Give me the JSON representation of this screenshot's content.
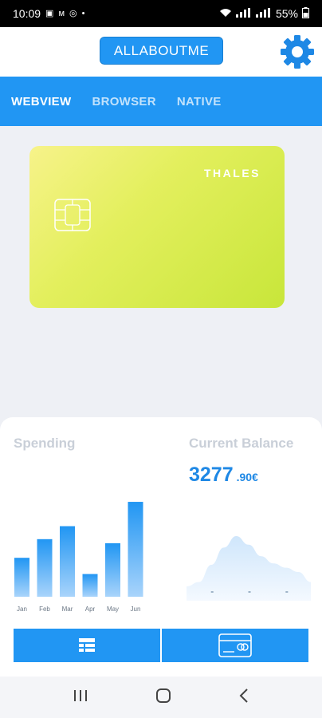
{
  "status_bar": {
    "time": "10:09",
    "battery": "55%",
    "time_color": "#ffffff"
  },
  "header": {
    "brand_label": "ALLABOUTME",
    "accent": "#2196f3"
  },
  "tabs": [
    {
      "label": "WEBVIEW",
      "active": true
    },
    {
      "label": "BROWSER",
      "active": false
    },
    {
      "label": "NATIVE",
      "active": false
    }
  ],
  "card": {
    "brand": "THALES",
    "gradient_start": "#f7f38a",
    "gradient_end": "#c8e63a"
  },
  "dashboard": {
    "spending_title": "Spending",
    "balance_title": "Current Balance",
    "balance_integer": "3277",
    "balance_decimal": ".90€"
  },
  "chart_data": [
    {
      "type": "bar",
      "categories": [
        "Jan",
        "Feb",
        "Mar",
        "Apr",
        "May",
        "Jun"
      ],
      "values": [
        48,
        71,
        87,
        28,
        66,
        117
      ],
      "title": "Spending",
      "xlabel": "",
      "ylabel": "",
      "ylim": [
        0,
        120
      ]
    },
    {
      "type": "area",
      "x": [
        0,
        1,
        2,
        3,
        4,
        5,
        6,
        7,
        8,
        9,
        10
      ],
      "values": [
        20,
        26,
        50,
        74,
        90,
        78,
        62,
        52,
        46,
        40,
        26
      ],
      "title": "Current Balance",
      "ylim": [
        0,
        100
      ]
    }
  ],
  "bottom_buttons": [
    {
      "icon": "list-icon"
    },
    {
      "icon": "credit-card-icon"
    }
  ],
  "nav": [
    {
      "icon": "recent-apps-icon"
    },
    {
      "icon": "home-icon"
    },
    {
      "icon": "back-icon"
    }
  ]
}
